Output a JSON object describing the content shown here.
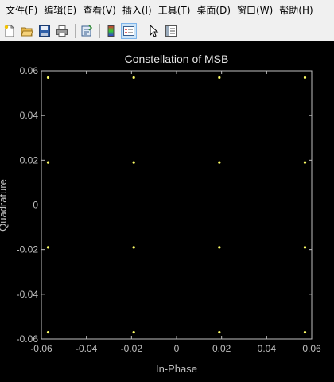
{
  "menu": {
    "items": [
      "文件(F)",
      "编辑(E)",
      "查看(V)",
      "插入(I)",
      "工具(T)",
      "桌面(D)",
      "窗口(W)",
      "帮助(H)"
    ]
  },
  "toolbar": {
    "buttons": [
      "new-figure-icon",
      "open-folder-icon",
      "save-icon",
      "print-icon",
      "link-plot-icon",
      "colorbar-icon",
      "legend-icon",
      "pointer-icon",
      "property-editor-icon"
    ]
  },
  "colors": {
    "background": "#000000",
    "axes_text": "#bfbfbf",
    "points": "#ffff66"
  },
  "chart_data": {
    "type": "scatter",
    "title": "Constellation of MSB",
    "xlabel": "In-Phase",
    "ylabel": "Quadrature",
    "xlim": [
      -0.06,
      0.06
    ],
    "ylim": [
      -0.06,
      0.06
    ],
    "xticks": [
      -0.06,
      -0.04,
      -0.02,
      0,
      0.02,
      0.04,
      0.06
    ],
    "xtick_labels": [
      "-0.06",
      "-0.04",
      "-0.02",
      "0",
      "0.02",
      "0.04",
      "0.06"
    ],
    "yticks": [
      -0.06,
      -0.04,
      -0.02,
      0,
      0.02,
      0.04,
      0.06
    ],
    "ytick_labels": [
      "-0.06",
      "-0.04",
      "-0.02",
      "0",
      "0.02",
      "0.04",
      "0.06"
    ],
    "grid": false,
    "points": [
      {
        "x": -0.057,
        "y": 0.057
      },
      {
        "x": -0.019,
        "y": 0.057
      },
      {
        "x": 0.019,
        "y": 0.057
      },
      {
        "x": 0.057,
        "y": 0.057
      },
      {
        "x": -0.057,
        "y": 0.019
      },
      {
        "x": -0.019,
        "y": 0.019
      },
      {
        "x": 0.019,
        "y": 0.019
      },
      {
        "x": 0.057,
        "y": 0.019
      },
      {
        "x": -0.057,
        "y": -0.019
      },
      {
        "x": -0.019,
        "y": -0.019
      },
      {
        "x": 0.019,
        "y": -0.019
      },
      {
        "x": 0.057,
        "y": -0.019
      },
      {
        "x": -0.057,
        "y": -0.057
      },
      {
        "x": -0.019,
        "y": -0.057
      },
      {
        "x": 0.019,
        "y": -0.057
      },
      {
        "x": 0.057,
        "y": -0.057
      }
    ]
  }
}
